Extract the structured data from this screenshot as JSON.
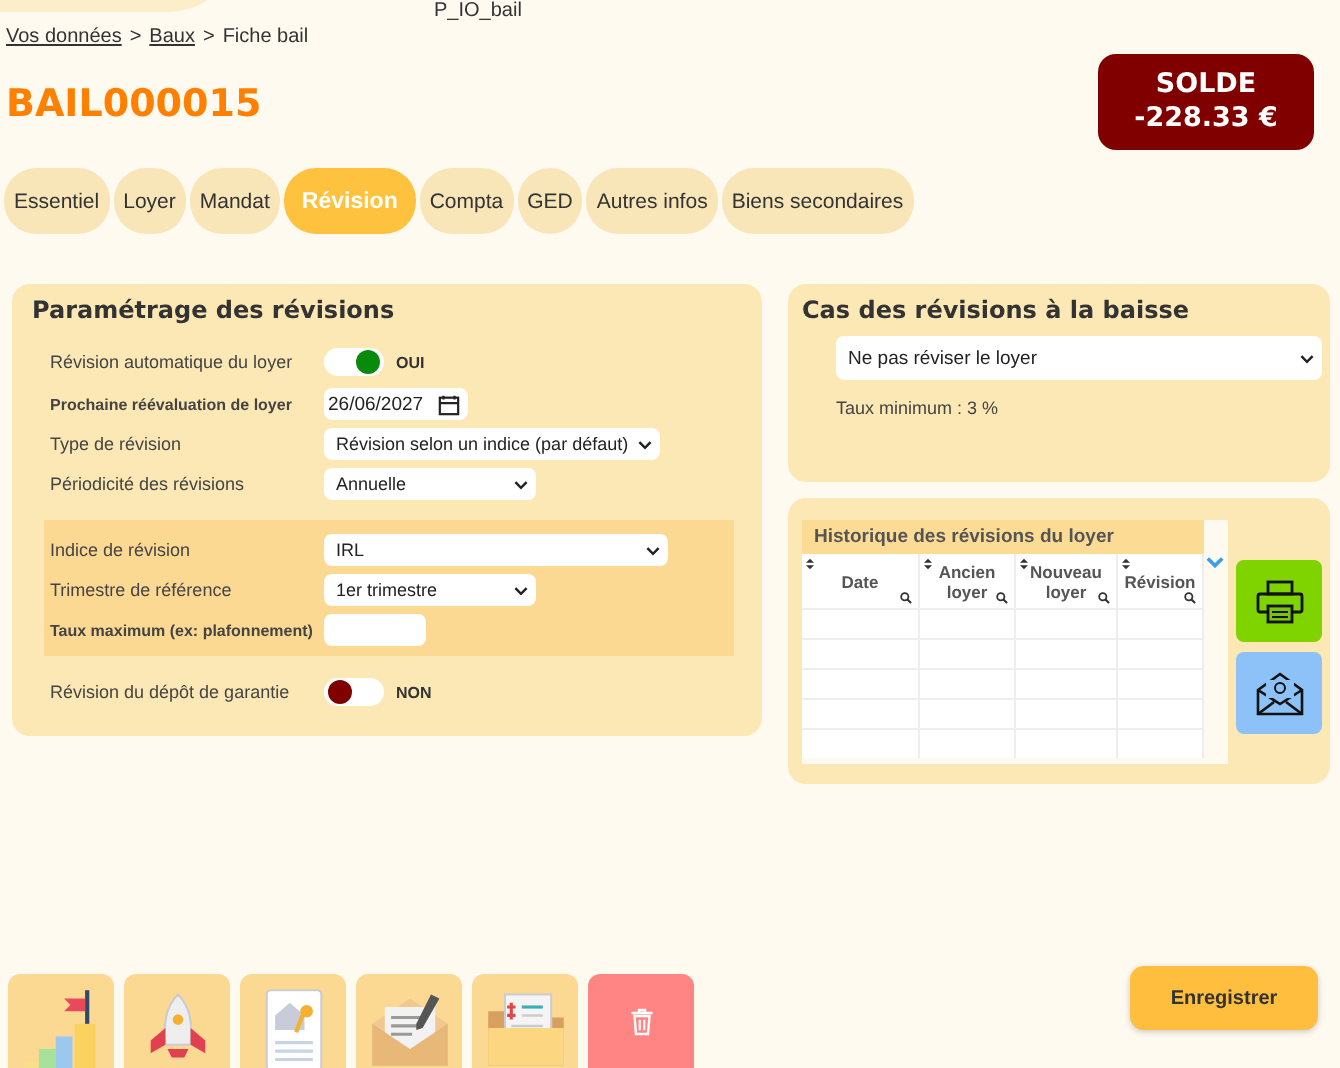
{
  "app_title": "P_IO_bail",
  "breadcrumb": {
    "separator": ">",
    "items": [
      {
        "label": "Vos données",
        "link": true
      },
      {
        "label": "Baux",
        "link": true
      },
      {
        "label": "Fiche bail",
        "link": false
      }
    ]
  },
  "record_id": "BAIL000015",
  "balance": {
    "label": "SOLDE",
    "amount": "-228.33 €"
  },
  "tabs": [
    {
      "label": "Essentiel",
      "selected": false
    },
    {
      "label": "Loyer",
      "selected": false
    },
    {
      "label": "Mandat",
      "selected": false
    },
    {
      "label": "Révision",
      "selected": true
    },
    {
      "label": "Compta",
      "selected": false
    },
    {
      "label": "GED",
      "selected": false
    },
    {
      "label": "Autres infos",
      "selected": false
    },
    {
      "label": "Biens secondaires",
      "selected": false
    }
  ],
  "settings": {
    "title": "Paramétrage des révisions",
    "fields": [
      {
        "kind": "toggle",
        "label": "Révision automatique du loyer",
        "on": true,
        "state_text": "OUI"
      },
      {
        "kind": "date",
        "label": "Prochaine réévaluation de loyer",
        "bold": true,
        "value": "26/06/2027"
      },
      {
        "kind": "select",
        "label": "Type de révision",
        "value": "Révision selon un indice (par défaut)"
      },
      {
        "kind": "select",
        "label": "Périodicité des révisions",
        "value": "Annuelle"
      }
    ],
    "index_group": [
      {
        "kind": "select",
        "label": "Indice de révision",
        "value": "IRL"
      },
      {
        "kind": "select",
        "label": "Trimestre de référence",
        "value": "1er trimestre"
      },
      {
        "kind": "text",
        "label": "Taux maximum (ex: plafonnement)",
        "bold": true
      }
    ],
    "after": [
      {
        "kind": "toggle",
        "label": "Révision du dépôt de garantie",
        "on": false,
        "state_text": "NON"
      }
    ]
  },
  "downward": {
    "title": "Cas des révisions à la baisse",
    "value": "Ne pas réviser le loyer",
    "note": "Taux minimum : 3 %"
  },
  "history": {
    "title": "Historique des révisions du loyer",
    "columns": [
      "Date",
      "Ancien loyer",
      "Nouveau loyer",
      "Révision"
    ]
  },
  "toolbar": [
    {
      "kind": "chart"
    },
    {
      "kind": "rocket"
    },
    {
      "kind": "house-document"
    },
    {
      "kind": "letter"
    },
    {
      "kind": "folder"
    },
    {
      "kind": "trash"
    }
  ],
  "save_button": "Enregistrer"
}
